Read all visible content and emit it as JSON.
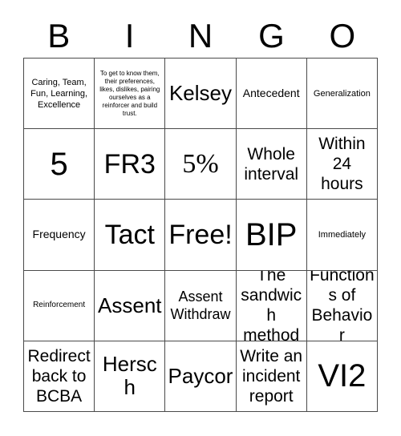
{
  "card": {
    "title": "BINGO",
    "header_letters": [
      "B",
      "I",
      "N",
      "G",
      "O"
    ],
    "columns": 5,
    "rows": 5,
    "free_space_label": "Free!",
    "colors": {
      "background": "#ffffff",
      "text": "#000000",
      "grid_line": "#4a4a4a"
    },
    "cells": [
      {
        "row": 1,
        "col": 1,
        "column_letter": "B",
        "text": "Caring, Team, Fun, Learning, Excellence",
        "size": "fs-s",
        "free": false
      },
      {
        "row": 1,
        "col": 2,
        "column_letter": "I",
        "text": "To get to know them, their preferences, likes, dislikes, pairing ourselves as a reinforcer and build trust.",
        "size": "fs-xxs",
        "free": false
      },
      {
        "row": 1,
        "col": 3,
        "column_letter": "N",
        "text": "Kelsey",
        "size": "fs-xxl",
        "free": false
      },
      {
        "row": 1,
        "col": 4,
        "column_letter": "G",
        "text": "Antecedent",
        "size": "fs-m",
        "free": false
      },
      {
        "row": 1,
        "col": 5,
        "column_letter": "O",
        "text": "Generalization",
        "size": "fs-s",
        "free": false
      },
      {
        "row": 2,
        "col": 1,
        "column_letter": "B",
        "text": "5",
        "size": "fs-h2",
        "free": false
      },
      {
        "row": 2,
        "col": 2,
        "column_letter": "I",
        "text": "FR3",
        "size": "fs-h1",
        "free": false
      },
      {
        "row": 2,
        "col": 3,
        "column_letter": "N",
        "text": "5%",
        "size": "fs-h1",
        "free": false
      },
      {
        "row": 2,
        "col": 4,
        "column_letter": "G",
        "text": "Whole interval",
        "size": "fs-xl",
        "free": false
      },
      {
        "row": 2,
        "col": 5,
        "column_letter": "O",
        "text": "Within 24 hours",
        "size": "fs-xl",
        "free": false
      },
      {
        "row": 3,
        "col": 1,
        "column_letter": "B",
        "text": "Frequency",
        "size": "fs-m",
        "free": false
      },
      {
        "row": 3,
        "col": 2,
        "column_letter": "I",
        "text": "Tact",
        "size": "fs-h1",
        "free": false
      },
      {
        "row": 3,
        "col": 3,
        "column_letter": "N",
        "text": "Free!",
        "size": "fs-h1",
        "free": true
      },
      {
        "row": 3,
        "col": 4,
        "column_letter": "G",
        "text": "BIP",
        "size": "fs-h2",
        "free": false
      },
      {
        "row": 3,
        "col": 5,
        "column_letter": "O",
        "text": "Immediately",
        "size": "fs-s",
        "free": false
      },
      {
        "row": 4,
        "col": 1,
        "column_letter": "B",
        "text": "Reinforcement",
        "size": "fs-xs",
        "free": false
      },
      {
        "row": 4,
        "col": 2,
        "column_letter": "I",
        "text": "Assent",
        "size": "fs-xxl",
        "free": false
      },
      {
        "row": 4,
        "col": 3,
        "column_letter": "N",
        "text": "Assent Withdraw",
        "size": "fs-l",
        "free": false
      },
      {
        "row": 4,
        "col": 4,
        "column_letter": "G",
        "text": "The sandwich method",
        "size": "fs-xl",
        "free": false
      },
      {
        "row": 4,
        "col": 5,
        "column_letter": "O",
        "text": "Functions of Behavior",
        "size": "fs-xl",
        "free": false
      },
      {
        "row": 5,
        "col": 1,
        "column_letter": "B",
        "text": "Redirect back to BCBA",
        "size": "fs-xl",
        "free": false
      },
      {
        "row": 5,
        "col": 2,
        "column_letter": "I",
        "text": "Hersch",
        "size": "fs-xxl",
        "free": false
      },
      {
        "row": 5,
        "col": 3,
        "column_letter": "N",
        "text": "Paycor",
        "size": "fs-xxl",
        "free": false
      },
      {
        "row": 5,
        "col": 4,
        "column_letter": "G",
        "text": "Write an incident report",
        "size": "fs-xl",
        "free": false
      },
      {
        "row": 5,
        "col": 5,
        "column_letter": "O",
        "text": "VI2",
        "size": "fs-h2",
        "free": false
      }
    ]
  }
}
